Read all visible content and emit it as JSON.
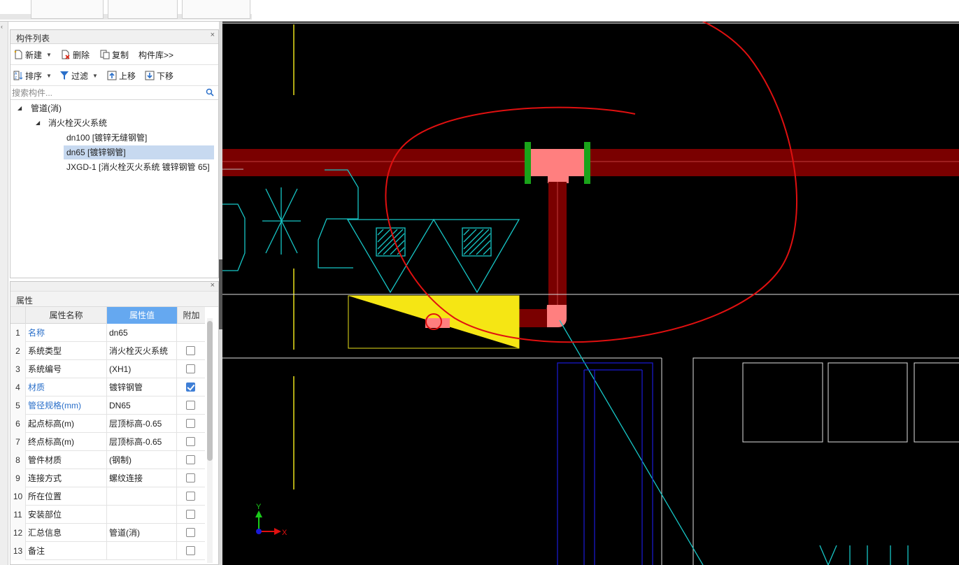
{
  "component_list": {
    "title": "构件列表",
    "close_icon": "close-icon",
    "toolbar": {
      "new_label": "新建",
      "delete_label": "删除",
      "copy_label": "复制",
      "library_label": "构件库>>",
      "sort_label": "排序",
      "filter_label": "过滤",
      "move_up_label": "上移",
      "move_down_label": "下移"
    },
    "search": {
      "placeholder": "搜索构件..."
    },
    "tree": {
      "root": "管道(消)",
      "system": "消火栓灭火系统",
      "items": [
        "dn100 [镀锌无缝钢管]",
        "dn65 [镀锌钢管]",
        "JXGD-1 [消火栓灭火系统 镀锌钢管 65]"
      ],
      "selected_index": 1
    }
  },
  "properties": {
    "title": "属性",
    "headers": {
      "num": "",
      "name": "属性名称",
      "value": "属性值",
      "extra": "附加"
    },
    "rows": [
      {
        "num": "1",
        "name": "名称",
        "value": "dn65",
        "blue": true,
        "checkbox": false,
        "checked": false
      },
      {
        "num": "2",
        "name": "系统类型",
        "value": "消火栓灭火系统",
        "blue": false,
        "checkbox": true,
        "checked": false
      },
      {
        "num": "3",
        "name": "系统编号",
        "value": "(XH1)",
        "blue": false,
        "checkbox": true,
        "checked": false
      },
      {
        "num": "4",
        "name": "材质",
        "value": "镀锌钢管",
        "blue": true,
        "checkbox": true,
        "checked": true
      },
      {
        "num": "5",
        "name": "管径规格(mm)",
        "value": "DN65",
        "blue": true,
        "checkbox": true,
        "checked": false
      },
      {
        "num": "6",
        "name": "起点标高(m)",
        "value": "层顶标高-0.65",
        "blue": false,
        "checkbox": true,
        "checked": false
      },
      {
        "num": "7",
        "name": "终点标高(m)",
        "value": "层顶标高-0.65",
        "blue": false,
        "checkbox": true,
        "checked": false
      },
      {
        "num": "8",
        "name": "管件材质",
        "value": "(钢制)",
        "blue": false,
        "checkbox": true,
        "checked": false
      },
      {
        "num": "9",
        "name": "连接方式",
        "value": "螺纹连接",
        "blue": false,
        "checkbox": true,
        "checked": false
      },
      {
        "num": "10",
        "name": "所在位置",
        "value": "",
        "blue": false,
        "checkbox": true,
        "checked": false
      },
      {
        "num": "11",
        "name": "安装部位",
        "value": "",
        "blue": false,
        "checkbox": true,
        "checked": false
      },
      {
        "num": "12",
        "name": "汇总信息",
        "value": "管道(消)",
        "blue": false,
        "checkbox": true,
        "checked": false
      },
      {
        "num": "13",
        "name": "备注",
        "value": "",
        "blue": false,
        "checkbox": true,
        "checked": false
      }
    ]
  },
  "canvas": {
    "axis_x_label": "X",
    "axis_y_label": "Y",
    "colors": {
      "background": "#000000",
      "pipe_main": "#7a0000",
      "pipe_fitting": "#ff7f7f",
      "flange": "#1aa31a",
      "cyan": "#17c6c6",
      "yellow_fill": "#f5e614",
      "annotation_red": "#e01010",
      "blue_line": "#1a1ad8"
    }
  },
  "colors": {
    "selection": "#c7d9f0",
    "blue_text": "#2a6fc9",
    "value_header": "#65a8f0"
  }
}
